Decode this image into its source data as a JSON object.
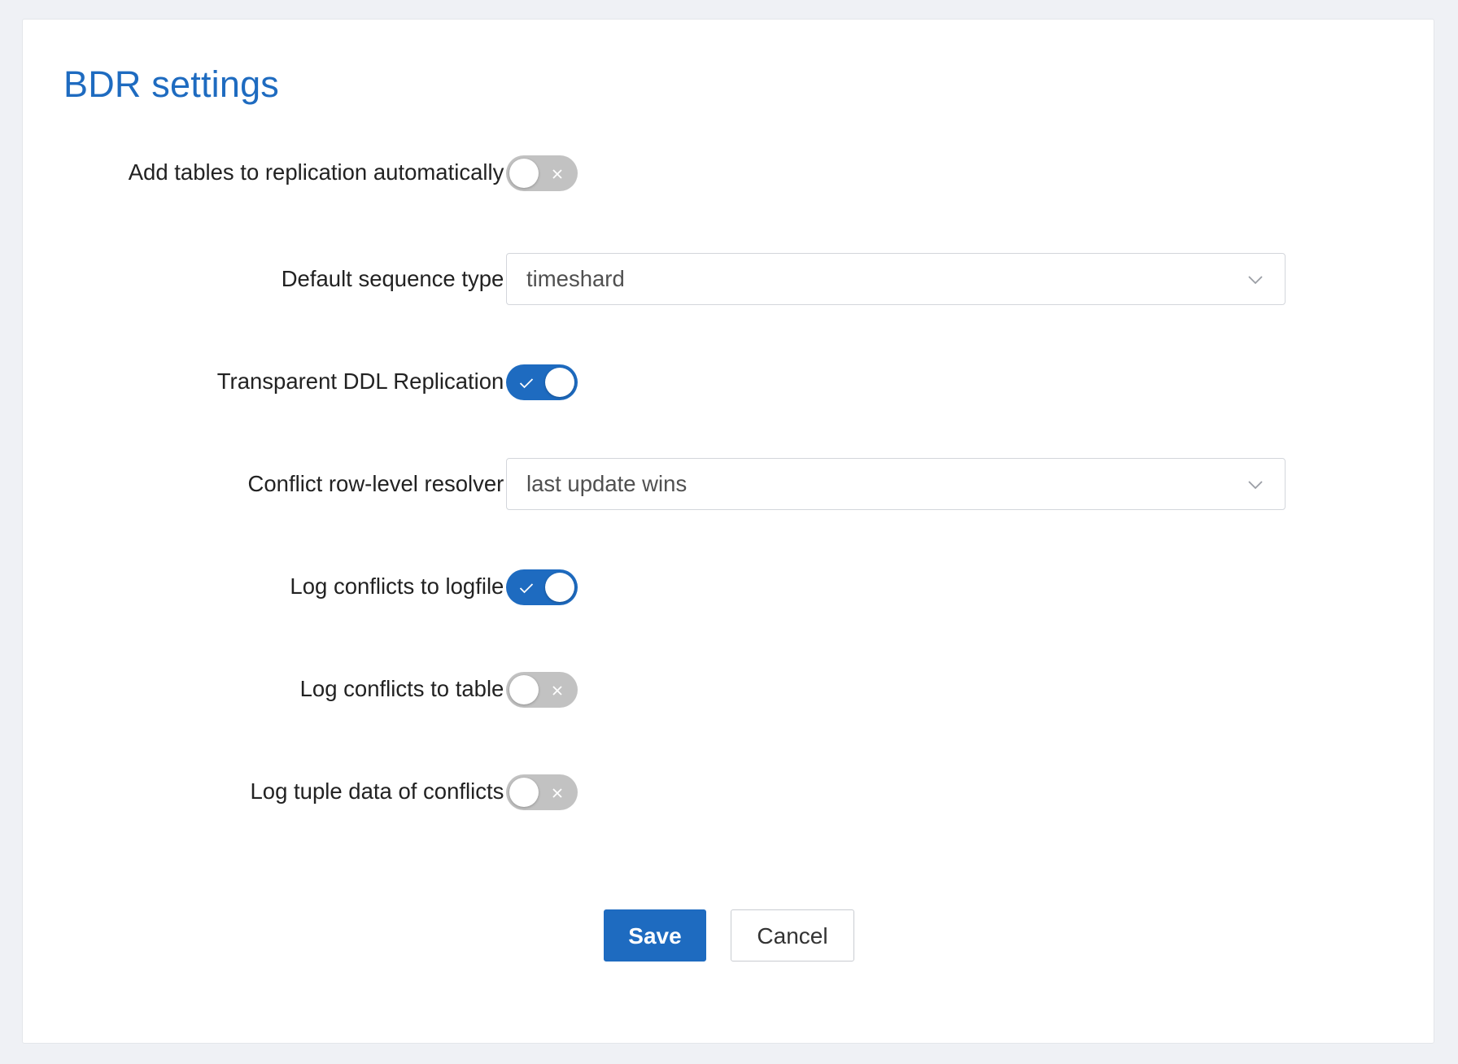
{
  "page": {
    "title": "BDR settings"
  },
  "form": {
    "add_tables": {
      "label": "Add tables to replication automatically",
      "value": "off"
    },
    "default_sequence": {
      "label": "Default sequence type",
      "value": "timeshard"
    },
    "transparent_ddl": {
      "label": "Transparent DDL Replication",
      "value": "on"
    },
    "conflict_resolver": {
      "label": "Conflict row-level resolver",
      "value": "last update wins"
    },
    "log_logfile": {
      "label": "Log conflicts to logfile",
      "value": "on"
    },
    "log_table": {
      "label": "Log conflicts to table",
      "value": "off"
    },
    "log_tuple": {
      "label": "Log tuple data of conflicts",
      "value": "off"
    },
    "colon": ":"
  },
  "actions": {
    "save_label": "Save",
    "cancel_label": "Cancel"
  },
  "icons": {
    "switch_on": "check-icon",
    "switch_off": "x-icon",
    "select_arrow": "chevron-down-icon"
  },
  "colors": {
    "accent": "#1e6bc0",
    "switch_off": "#c2c2c2",
    "background": "#eff1f5"
  }
}
